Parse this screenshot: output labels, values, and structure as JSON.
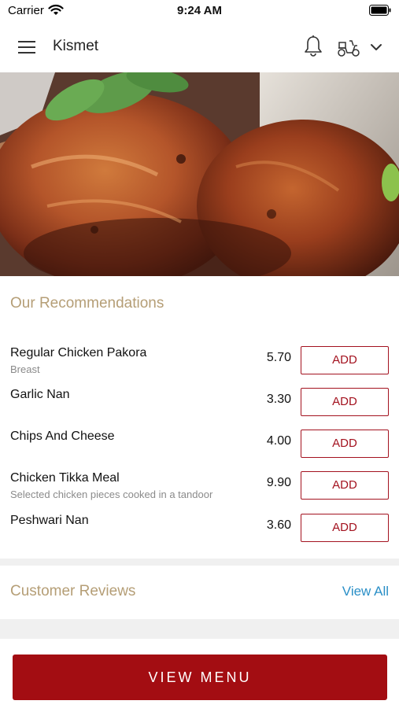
{
  "status_bar": {
    "carrier": "Carrier",
    "time": "9:24 AM"
  },
  "header": {
    "title": "Kismet",
    "icons": [
      "menu-icon",
      "bell-icon",
      "scooter-icon",
      "chevron-down-icon"
    ]
  },
  "recommendations": {
    "title": "Our Recommendations",
    "items": [
      {
        "name": "Regular Chicken Pakora",
        "description": "Breast",
        "price": "5.70",
        "button": "ADD"
      },
      {
        "name": "Garlic Nan",
        "description": "",
        "price": "3.30",
        "button": "ADD"
      },
      {
        "name": "Chips And Cheese",
        "description": "",
        "price": "4.00",
        "button": "ADD"
      },
      {
        "name": "Chicken Tikka Meal",
        "description": "Selected chicken pieces cooked in a tandoor",
        "price": "9.90",
        "button": "ADD"
      },
      {
        "name": "Peshwari Nan",
        "description": "",
        "price": "3.60",
        "button": "ADD"
      }
    ]
  },
  "reviews": {
    "title": "Customer Reviews",
    "view_all": "View All"
  },
  "footer": {
    "view_menu": "VIEW MENU"
  },
  "colors": {
    "accent": "#a30d12",
    "section_title": "#b59e76",
    "link": "#2a8fc7"
  }
}
